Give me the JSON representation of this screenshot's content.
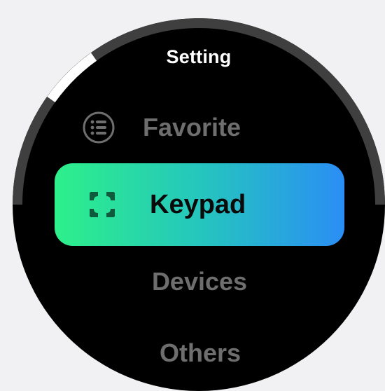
{
  "screen": {
    "title": "Setting"
  },
  "menu": {
    "items": [
      {
        "label": "Favorite",
        "icon": "list-icon"
      },
      {
        "label": "Keypad",
        "icon": "keypad-icon",
        "selected": true
      },
      {
        "label": "Devices"
      },
      {
        "label": "Others"
      }
    ]
  },
  "scroll": {
    "position_fraction": 0.1
  },
  "colors": {
    "background": "#000000",
    "highlight_start": "#2df08a",
    "highlight_end": "#2a8ef5",
    "inactive_text": "#6e6e6e",
    "active_text": "#0a0a0a",
    "title_text": "#ffffff",
    "scroll_track": "#3f3f3f",
    "scroll_thumb": "#ffffff"
  }
}
